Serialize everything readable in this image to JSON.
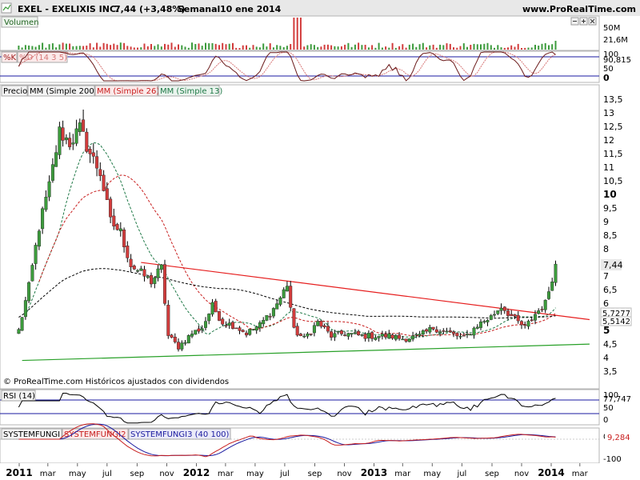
{
  "header": {
    "title": "EXEL - EXELIXIS INC.",
    "price_change": "7,44 (+3,48%)",
    "period": "Semanal",
    "date": "10 ene 2014",
    "site": "www.ProRealTime.com"
  },
  "colors": {
    "up": "#3c9b3c",
    "down": "#d23c3c",
    "ma200": "#000000",
    "ma26": "#c81e1e",
    "ma13": "#1e7846",
    "resistance": "#e61e1e",
    "support": "#28a028",
    "panel_bg": "#ffffff",
    "border": "#b4b4b4"
  },
  "icons": [
    "minus-icon",
    "plus-icon",
    "close-icon"
  ],
  "panels": {
    "volume": {
      "label": "Volumen",
      "ticks": [
        "50M",
        "21,6M"
      ]
    },
    "stoch": {
      "label_k": "%K",
      "label_d": "%D (14 3 5)",
      "ticks": [
        "100",
        "90,815",
        "50",
        "0"
      ]
    },
    "price": {
      "labels": {
        "price": "Precio",
        "ma200": "MM (Simple 200)",
        "ma26": "MM (Simple 26)",
        "ma13": "MM (Simple 13)"
      },
      "y_ticks": [
        "13,5",
        "13",
        "12,5",
        "12",
        "11,5",
        "11",
        "10,5",
        "10",
        "9,5",
        "9",
        "8,5",
        "8",
        "7,5",
        "7",
        "6,5",
        "6",
        "5,5",
        "5",
        "4,5",
        "4",
        "3,5"
      ],
      "last_price_label": "7,44",
      "ma200_label": "5,7277",
      "ma26_label": "5,5142",
      "footer": "© ProRealTime.com  Históricos ajustados con dividendos"
    },
    "rsi": {
      "label": "RSI (14)",
      "ticks": [
        "100",
        "77,747",
        "50",
        "0"
      ]
    },
    "sysfungi": {
      "label1": "SYSTEMFUNGI",
      "label2": "SYSTEMFUNGI2",
      "label3": "SYSTEMFUNGI3 (40 100)",
      "ticks": [
        "0",
        "9,284",
        "-100"
      ]
    }
  },
  "x_axis": {
    "labels": [
      "2011",
      "mar",
      "may",
      "jul",
      "sep",
      "nov",
      "2012",
      "mar",
      "may",
      "jul",
      "sep",
      "nov",
      "2013",
      "mar",
      "may",
      "jul",
      "sep",
      "nov",
      "2014",
      "mar"
    ],
    "bold": [
      "2011",
      "2012",
      "2013",
      "2014"
    ]
  },
  "chart_data": {
    "type": "candlestick",
    "title": "EXEL - EXELIXIS INC.",
    "interval": "weekly",
    "ylim": [
      3.3,
      13.7
    ],
    "anchors": [
      {
        "x": "2010-12-31",
        "y": 5.0
      },
      {
        "x": "2011-01-21",
        "y": 6.6
      },
      {
        "x": "2011-02-11",
        "y": 8.8
      },
      {
        "x": "2011-03-04",
        "y": 10.3
      },
      {
        "x": "2011-03-25",
        "y": 12.3
      },
      {
        "x": "2011-04-15",
        "y": 11.9
      },
      {
        "x": "2011-05-06",
        "y": 12.4
      },
      {
        "x": "2011-05-27",
        "y": 11.5
      },
      {
        "x": "2011-06-17",
        "y": 10.8
      },
      {
        "x": "2011-07-08",
        "y": 9.0
      },
      {
        "x": "2011-07-29",
        "y": 8.6
      },
      {
        "x": "2011-08-19",
        "y": 7.4
      },
      {
        "x": "2011-09-09",
        "y": 7.1
      },
      {
        "x": "2011-09-30",
        "y": 6.8
      },
      {
        "x": "2011-10-21",
        "y": 7.3
      },
      {
        "x": "2011-11-04",
        "y": 4.8
      },
      {
        "x": "2011-11-25",
        "y": 4.4
      },
      {
        "x": "2011-12-23",
        "y": 4.9
      },
      {
        "x": "2012-01-13",
        "y": 5.1
      },
      {
        "x": "2012-02-03",
        "y": 5.9
      },
      {
        "x": "2012-02-24",
        "y": 5.3
      },
      {
        "x": "2012-03-16",
        "y": 5.2
      },
      {
        "x": "2012-04-13",
        "y": 4.9
      },
      {
        "x": "2012-05-11",
        "y": 5.2
      },
      {
        "x": "2012-06-08",
        "y": 5.8
      },
      {
        "x": "2012-06-22",
        "y": 6.2
      },
      {
        "x": "2012-07-06",
        "y": 6.7
      },
      {
        "x": "2012-07-20",
        "y": 5.0
      },
      {
        "x": "2012-08-10",
        "y": 4.7
      },
      {
        "x": "2012-09-07",
        "y": 5.3
      },
      {
        "x": "2012-10-05",
        "y": 4.8
      },
      {
        "x": "2012-11-02",
        "y": 4.9
      },
      {
        "x": "2012-12-07",
        "y": 4.8
      },
      {
        "x": "2013-01-04",
        "y": 4.8
      },
      {
        "x": "2013-02-01",
        "y": 4.8
      },
      {
        "x": "2013-03-01",
        "y": 4.7
      },
      {
        "x": "2013-04-05",
        "y": 4.8
      },
      {
        "x": "2013-05-03",
        "y": 5.1
      },
      {
        "x": "2013-06-07",
        "y": 4.9
      },
      {
        "x": "2013-07-05",
        "y": 4.7
      },
      {
        "x": "2013-08-02",
        "y": 5.2
      },
      {
        "x": "2013-08-30",
        "y": 5.5
      },
      {
        "x": "2013-09-20",
        "y": 5.9
      },
      {
        "x": "2013-10-18",
        "y": 5.4
      },
      {
        "x": "2013-11-08",
        "y": 5.1
      },
      {
        "x": "2013-11-29",
        "y": 5.6
      },
      {
        "x": "2013-12-20",
        "y": 6.0
      },
      {
        "x": "2014-01-10",
        "y": 7.44
      }
    ],
    "last_close": 7.44,
    "change_pct": 3.48,
    "ma200_last": 5.7277,
    "ma26_last": 5.5142,
    "resistance_line": [
      {
        "x": "2011-09-09",
        "y": 7.5
      },
      {
        "x": "2014-03-21",
        "y": 5.4
      }
    ],
    "support_line": [
      {
        "x": "2011-01-07",
        "y": 3.9
      },
      {
        "x": "2014-03-21",
        "y": 4.5
      }
    ],
    "volume_last": "21,6M",
    "stoch_k_last": 90.815,
    "rsi_last": 77.747,
    "sysfungi_last": 9.284
  }
}
